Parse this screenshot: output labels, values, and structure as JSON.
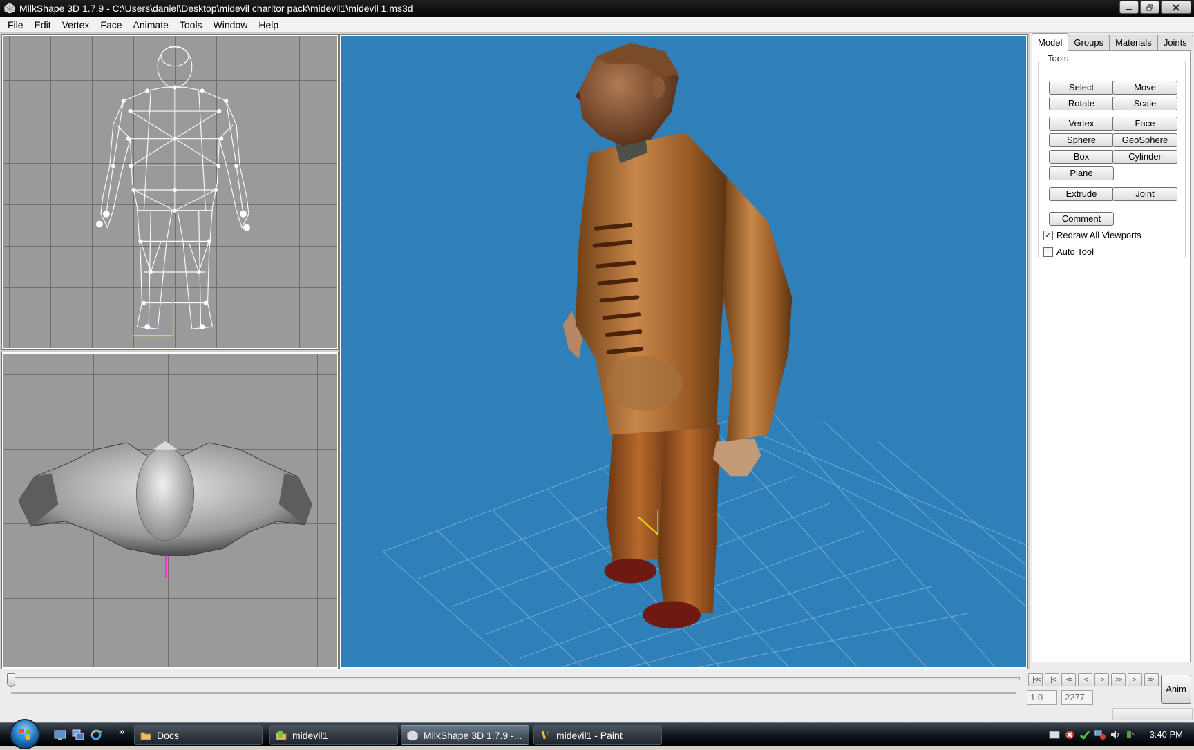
{
  "window": {
    "title": "MilkShape 3D 1.7.9 - C:\\Users\\daniel\\Desktop\\midevil charitor pack\\midevil1\\midevil 1.ms3d"
  },
  "menu": [
    "File",
    "Edit",
    "Vertex",
    "Face",
    "Animate",
    "Tools",
    "Window",
    "Help"
  ],
  "panel": {
    "tabs": [
      "Model",
      "Groups",
      "Materials",
      "Joints"
    ],
    "active_tab": "Model",
    "group_title": "Tools",
    "buttons": [
      "Select",
      "Move",
      "Rotate",
      "Scale",
      "Vertex",
      "Face",
      "Sphere",
      "GeoSphere",
      "Box",
      "Cylinder",
      "Plane",
      "Extrude",
      "Joint",
      "Comment"
    ],
    "checkboxes": [
      {
        "label": "Redraw All Viewports",
        "checked": true
      },
      {
        "label": "Auto Tool",
        "checked": false
      }
    ]
  },
  "animation": {
    "playback_buttons": [
      "|<<",
      "|<",
      "<<",
      "<",
      ">",
      ">>",
      ">|",
      ">>|"
    ],
    "start_frame": "1.0",
    "end_frame": "2277",
    "anim_button": "Anim"
  },
  "taskbar": {
    "more_glyph": "»",
    "tasks": [
      "Docs",
      "midevil1",
      "MilkShape 3D 1.7.9 -...",
      "midevil1 - Paint"
    ],
    "active_task": 2,
    "clock": "3:40 PM"
  },
  "colors": {
    "viewport_3d_bg": "#2f7fb8",
    "ortho_bg": "#9a9a9a"
  }
}
